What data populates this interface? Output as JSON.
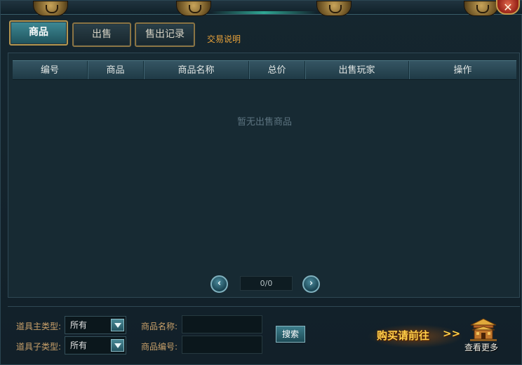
{
  "tabs": [
    {
      "label": "商品",
      "active": true
    },
    {
      "label": "出售",
      "active": false
    },
    {
      "label": "售出记录",
      "active": false
    }
  ],
  "trade_help_link": "交易说明",
  "table": {
    "columns": [
      "编号",
      "商品",
      "商品名称",
      "总价",
      "出售玩家",
      "操作"
    ],
    "rows": [],
    "empty_message": "暂无出售商品"
  },
  "pager": {
    "display": "0/0"
  },
  "filters": {
    "main_type_label": "道具主类型:",
    "main_type_value": "所有",
    "sub_type_label": "道具子类型:",
    "sub_type_value": "所有",
    "name_label": "商品名称:",
    "name_value": "",
    "id_label": "商品编号:",
    "id_value": "",
    "search_label": "搜索"
  },
  "promo": {
    "buy_text": "购买请前往",
    "arrows": ">>",
    "view_more": "查看更多"
  },
  "colors": {
    "accent_gold": "#e8a23a",
    "tab_active": "#3f8a95",
    "label_color": "#c8a06a"
  }
}
